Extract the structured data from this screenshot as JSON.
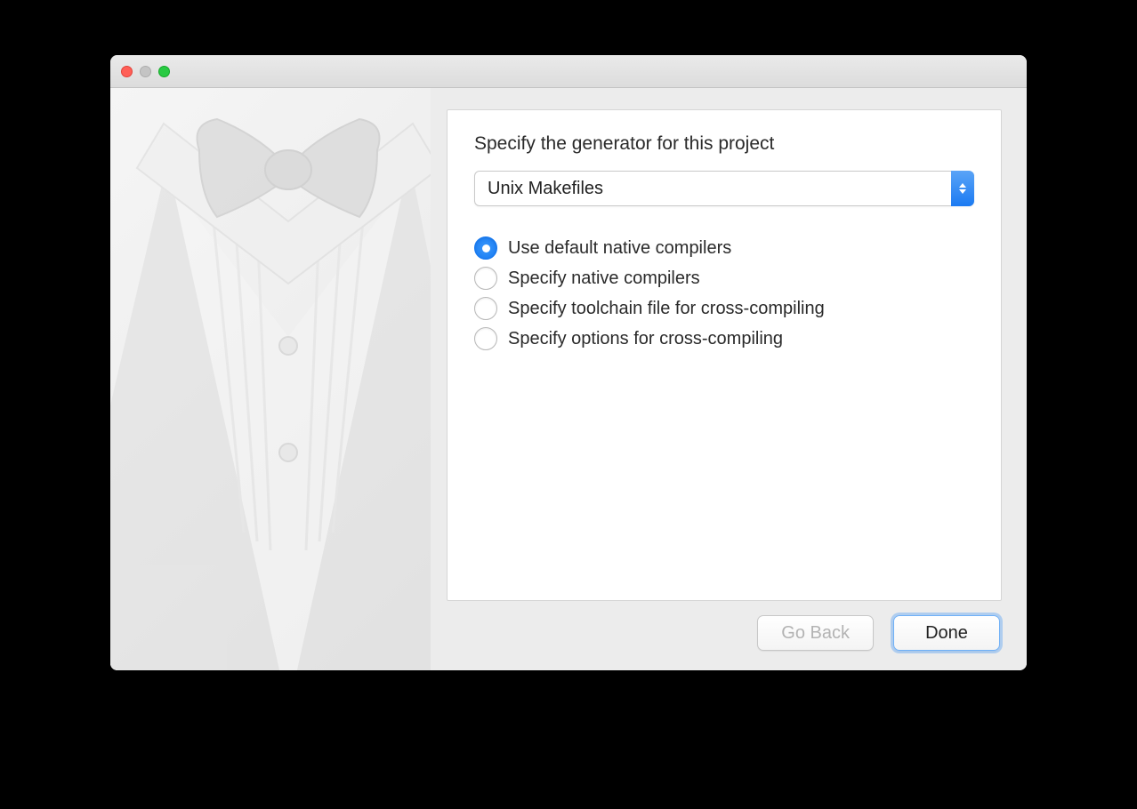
{
  "dialog": {
    "heading": "Specify the generator for this project",
    "generator_selected": "Unix Makefiles",
    "options": [
      {
        "label": "Use default native compilers",
        "selected": true
      },
      {
        "label": "Specify native compilers",
        "selected": false
      },
      {
        "label": "Specify toolchain file for cross-compiling",
        "selected": false
      },
      {
        "label": "Specify options for cross-compiling",
        "selected": false
      }
    ],
    "buttons": {
      "back": "Go Back",
      "done": "Done"
    }
  }
}
